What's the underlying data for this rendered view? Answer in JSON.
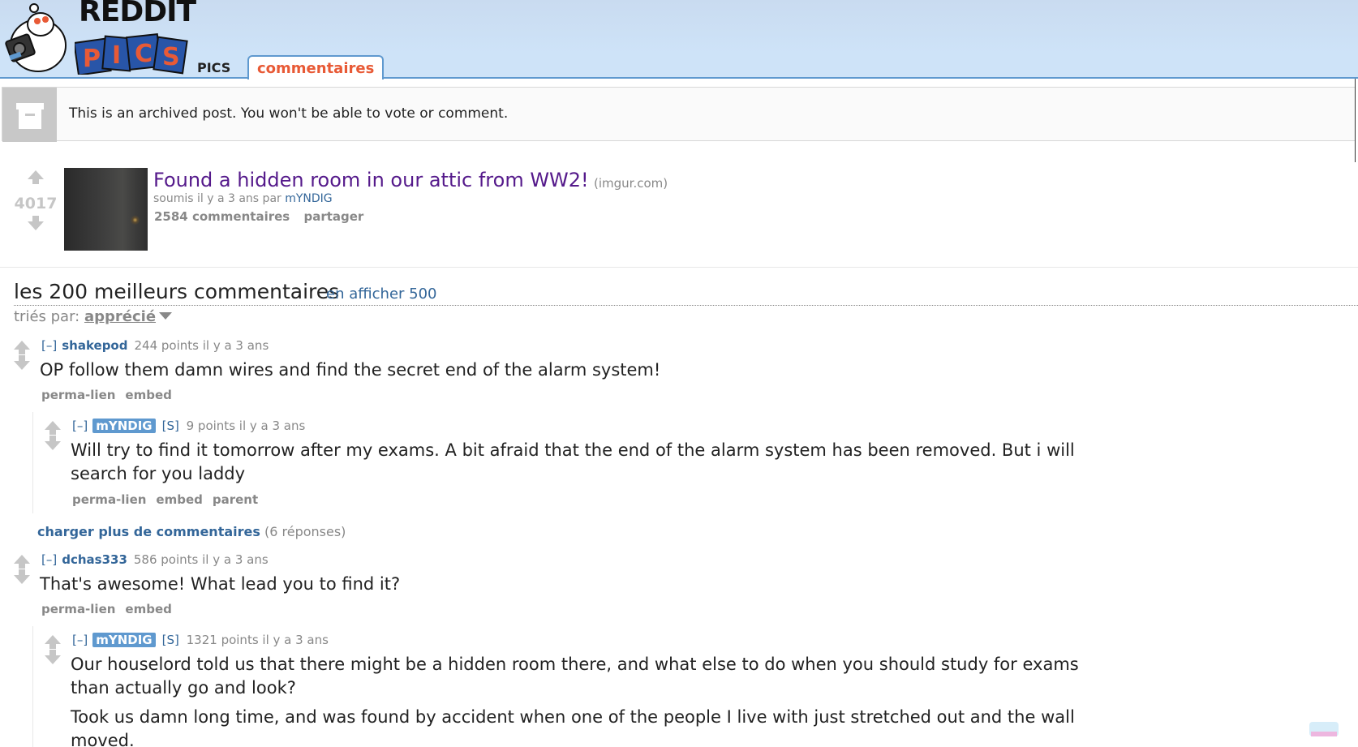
{
  "header": {
    "logo_text": "REDDIT",
    "logo_sub": "PICS",
    "tabs": [
      {
        "label": "PICS"
      },
      {
        "label": "commentaires"
      }
    ]
  },
  "archived": {
    "message": "This is an archived post. You won't be able to vote or comment."
  },
  "post": {
    "score": "4017",
    "title": "Found a hidden room in our attic from WW2!",
    "domain": "(imgur.com)",
    "tagline_prefix": "soumis il y a 3 ans par",
    "author": "mYNDIG",
    "comments_label": "2584 commentaires",
    "share_label": "partager"
  },
  "comments_header": {
    "title": "les 200 meilleurs commentaires",
    "show_more": "en afficher 500",
    "sort_prefix": "triés par:",
    "sort_value": "apprécié"
  },
  "comments": [
    {
      "toggle": "[–]",
      "author": "shakepod",
      "meta": "244 points il y a 3 ans",
      "body": [
        "OP follow them damn wires and find the secret end of the alarm system!"
      ],
      "links": [
        "perma-lien",
        "embed"
      ]
    },
    {
      "toggle": "[–]",
      "author": "mYNDIG",
      "submitter": "[S]",
      "meta": "9 points il y a 3 ans",
      "body": [
        "Will try to find it tomorrow after my exams. A bit afraid that the end of the alarm system has been removed. But i will",
        "search for you laddy"
      ],
      "links": [
        "perma-lien",
        "embed",
        "parent"
      ]
    },
    {
      "toggle": "[–]",
      "author": "dchas333",
      "meta": "586 points il y a 3 ans",
      "body": [
        "That's awesome! What lead you to find it?"
      ],
      "links": [
        "perma-lien",
        "embed"
      ]
    },
    {
      "toggle": "[–]",
      "author": "mYNDIG",
      "submitter": "[S]",
      "meta": "1321 points il y a 3 ans",
      "body": [
        "Our houselord told us that there might be a hidden room there, and what else to do when you should study for exams",
        "than actually go and look?",
        "Took us damn long time, and was found by accident when one of the people I live with just stretched out and the wall",
        "moved."
      ]
    }
  ],
  "load_more": {
    "link": "charger plus de commentaires",
    "count": "(6 réponses)"
  },
  "colors": {
    "header_bg": "#cee3f8",
    "accent": "#5f99cf",
    "tab_active": "#e85a36",
    "title_visited": "#551a8b",
    "link": "#336699"
  }
}
